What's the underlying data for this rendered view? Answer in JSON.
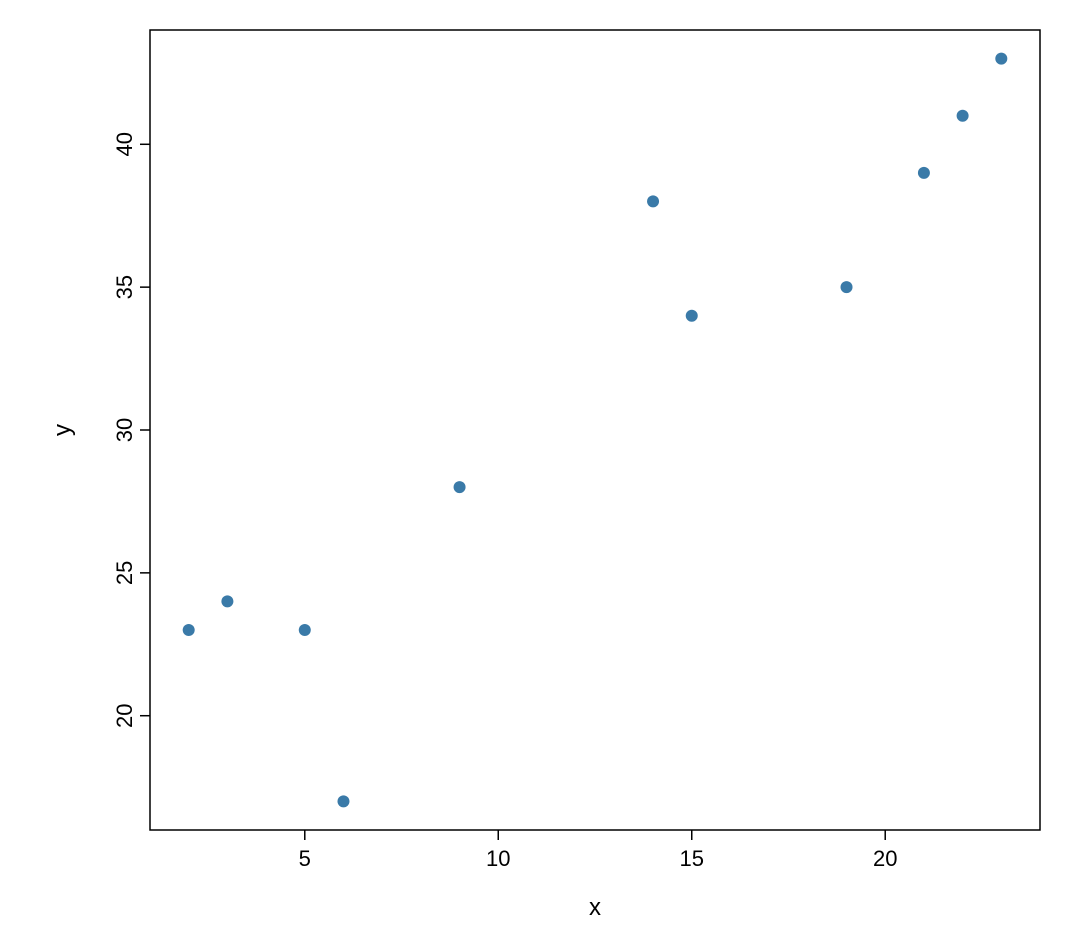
{
  "chart_data": {
    "type": "scatter",
    "title": "",
    "xlabel": "x",
    "ylabel": "y",
    "xlim": [
      1,
      24
    ],
    "ylim": [
      16,
      44
    ],
    "x_ticks": [
      5,
      10,
      15,
      20
    ],
    "y_ticks": [
      20,
      25,
      30,
      35,
      40
    ],
    "points": [
      {
        "x": 2,
        "y": 23
      },
      {
        "x": 3,
        "y": 24
      },
      {
        "x": 5,
        "y": 23
      },
      {
        "x": 6,
        "y": 17
      },
      {
        "x": 9,
        "y": 28
      },
      {
        "x": 14,
        "y": 38
      },
      {
        "x": 15,
        "y": 34
      },
      {
        "x": 19,
        "y": 35
      },
      {
        "x": 21,
        "y": 39
      },
      {
        "x": 22,
        "y": 41
      },
      {
        "x": 23,
        "y": 43
      }
    ],
    "point_color": "#3a7aa8",
    "point_radius": 6
  }
}
